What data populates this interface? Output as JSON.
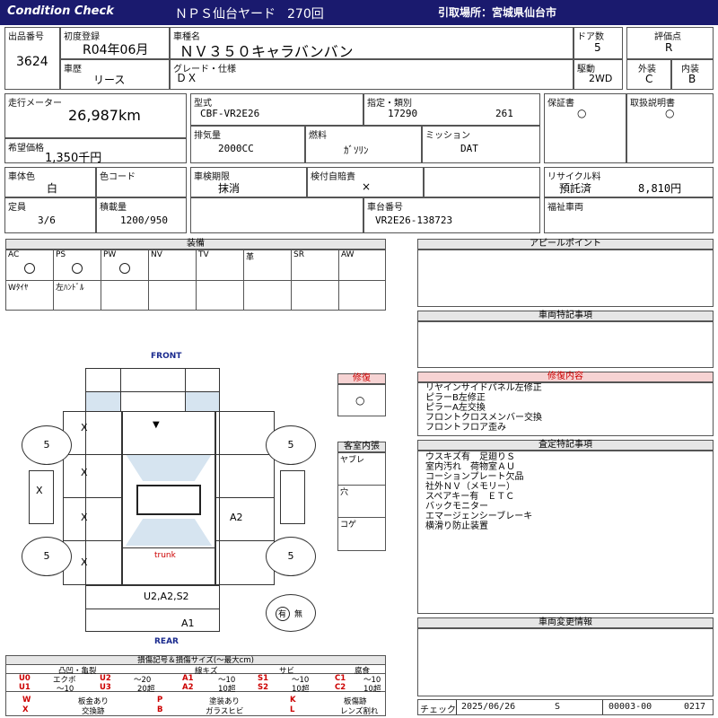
{
  "header": {
    "title": "Condition Check",
    "auction_name": "ＮＰＳ仙台ヤード",
    "session": "270回",
    "pickup": "引取場所：宮城県仙台市"
  },
  "row1": {
    "lot_label": "出品番号",
    "lot_value": "3624",
    "first_reg_label": "初度登録",
    "first_reg_value": "R04年06月",
    "model_label": "車種名",
    "model_value": "ＮＶ３５０キャラバンバン",
    "doors_label": "ドア数",
    "doors_value": "5",
    "score_label": "評価点",
    "score_value": "R",
    "history_label": "車歴",
    "history_value": "リース",
    "grade_label": "グレード・仕様",
    "grade_value": "ＤＸ",
    "drive_label": "駆動",
    "drive_value": "2WD",
    "ext_label": "外装",
    "ext_value": "C",
    "int_label": "内装",
    "int_value": "B"
  },
  "row2": {
    "odo_label": "走行メーター",
    "odo_value": "26,987km",
    "type_label": "型式",
    "type_value": "CBF-VR2E26",
    "class_label": "指定・類別",
    "class_value1": "17290",
    "class_value2": "261",
    "warranty_label": "保証書",
    "warranty_value": "○",
    "manual_label": "取扱説明書",
    "manual_value": "○",
    "price_label": "希望価格",
    "price_value": "1,350千円",
    "disp_label": "排気量",
    "disp_value": "2000CC",
    "fuel_label": "燃料",
    "fuel_value": "ｶﾞｿﾘﾝ",
    "mission_label": "ミッション",
    "mission_value": "DAT"
  },
  "row3": {
    "color_label": "車体色",
    "color_value": "白",
    "colorcode_label": "色コード",
    "colorcode_value": "",
    "inspection_label": "車検期限",
    "inspection_value": "抹消",
    "insurance_label": "検付自賠責",
    "insurance_value": "×",
    "recycle_label": "リサイクル料",
    "recycle_status": "預託済",
    "recycle_value": "8,810円",
    "capacity_label": "定員",
    "capacity_value": "3/6",
    "load_label": "積載量",
    "load_value": "1200/950",
    "chassis_label": "車台番号",
    "chassis_value": "VR2E26-138723",
    "welfare_label": "福祉車両",
    "welfare_value": ""
  },
  "equipment": {
    "title": "装備",
    "items": [
      {
        "label": "AC",
        "value": "○"
      },
      {
        "label": "PS",
        "value": "○"
      },
      {
        "label": "PW",
        "value": "○"
      },
      {
        "label": "NV",
        "value": ""
      },
      {
        "label": "TV",
        "value": ""
      },
      {
        "label": "革",
        "value": ""
      },
      {
        "label": "SR",
        "value": ""
      },
      {
        "label": "AW",
        "value": ""
      },
      {
        "label": "Wﾀｲﾔ",
        "value": ""
      },
      {
        "label": "左ﾊﾝﾄﾞﾙ",
        "value": ""
      }
    ]
  },
  "panels": {
    "appeal_title": "アピールポイント",
    "special_title": "車両特記事項",
    "repair_title": "修復内容",
    "repair_items": [
      "リヤインサイドパネル左修正",
      "ピラーB左修正",
      "ピラーA左交換",
      "フロントクロスメンバー交換",
      "フロントフロア歪み"
    ],
    "inspect_title": "査定特記事項",
    "inspect_items": [
      "ウスキズ有　足廻りＳ",
      "室内汚れ　荷物室ＡＵ",
      "コーションプレート欠品",
      "社外ＮＶ（メモリー）",
      "スペアキー有　ＥＴＣ",
      "バックモニター",
      "エマージェンシーブレーキ",
      "横滑り防止装置"
    ],
    "change_title": "車両変更情報",
    "check_label": "チェック",
    "check_date": "2025/06/26",
    "check_code": "S",
    "check_num1": "00003-00",
    "check_num2": "0217"
  },
  "diagram": {
    "front": "FRONT",
    "rear": "REAR",
    "trunk": "trunk",
    "tire_fl": "5",
    "tire_fr": "5",
    "tire_rl": "5",
    "tire_rr": "5",
    "mark_l1": "X",
    "mark_l2": "X",
    "mark_l3": "X",
    "mark_l4": "X",
    "mark_side": "X",
    "mark_hood": "▼",
    "mark_r3": "A2",
    "mark_rear1": "U2,A2,S2",
    "mark_rear2": "A1",
    "spare_label1": "有",
    "spare_label2": "無"
  },
  "repair_box": {
    "title": "修復",
    "value": "○"
  },
  "cabin": {
    "title": "客室内張",
    "items": [
      "ヤブレ",
      "穴",
      "コゲ"
    ]
  },
  "legend": {
    "title": "損傷記号＆損傷サイズ(〜最大cm)",
    "groups": [
      "凸凹・亀裂",
      "線キズ",
      "サビ",
      "腐食"
    ],
    "rows": [
      [
        {
          "c": "U0",
          "t": "エクボ"
        },
        {
          "c": "U2",
          "t": "〜20"
        },
        {
          "c": "A1",
          "t": "〜10"
        },
        {
          "c": "S1",
          "t": "〜10"
        },
        {
          "c": "C1",
          "t": "〜10"
        }
      ],
      [
        {
          "c": "U1",
          "t": "〜10"
        },
        {
          "c": "U3",
          "t": "20超"
        },
        {
          "c": "A2",
          "t": "10超"
        },
        {
          "c": "S2",
          "t": "10超"
        },
        {
          "c": "C2",
          "t": "10超"
        }
      ]
    ],
    "rows2": [
      [
        {
          "c": "W",
          "t": "板金あり"
        },
        {
          "c": "P",
          "t": "塗装あり"
        },
        {
          "c": "K",
          "t": "板傷跡"
        }
      ],
      [
        {
          "c": "X",
          "t": "交換跡"
        },
        {
          "c": "B",
          "t": "ガラスヒビ"
        },
        {
          "c": "L",
          "t": "レンズ割れ"
        }
      ]
    ]
  }
}
